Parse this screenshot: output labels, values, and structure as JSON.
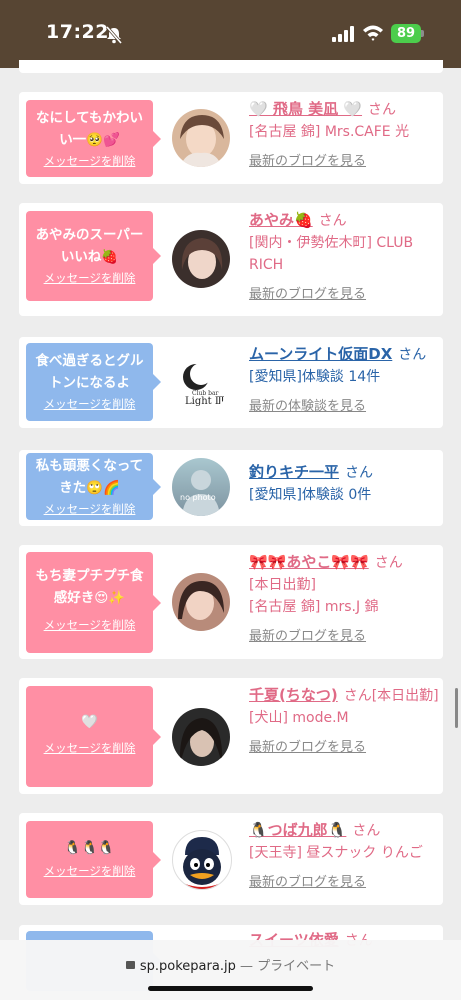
{
  "status": {
    "time": "17:22",
    "battery": "89"
  },
  "cards": [
    {
      "message": "なにしてもかわいい一🥺💕",
      "delete_label": "メッセージを削除",
      "bubble_color": "#ff8fa4",
      "name": "🤍 飛鳥 美凪 🤍",
      "suffix": "さん",
      "details": [
        "[名古屋 錦] Mrs.CAFE 光"
      ],
      "link": "最新のブログを見る"
    },
    {
      "message": "あやみのスーパーいいね🍓",
      "delete_label": "メッセージを削除",
      "bubble_color": "#ff8fa4",
      "name": "あやみ🍓",
      "suffix": "さん",
      "details": [
        "[関内・伊勢佐木町] CLUB RICH"
      ],
      "link": "最新のブログを見る"
    },
    {
      "message": "食べ過ぎるとグルトンになるよ",
      "delete_label": "メッセージを削除",
      "bubble_color": "#8fb8ec",
      "name": "ムーンライト仮面DX",
      "suffix": "さん",
      "details": [
        "[愛知県]体験談 14件"
      ],
      "link": "最新の体験談を見る",
      "avatar_text": [
        "Club bar",
        "Light Ⅲ"
      ]
    },
    {
      "message": "私も頭悪くなってきた🙄🌈",
      "delete_label": "メッセージを削除",
      "bubble_color": "#8fb8ec",
      "name": "釣りキチ一平",
      "suffix": "さん",
      "details": [
        "[愛知県]体験談 0件"
      ],
      "avatar_text": [
        "no photo"
      ]
    },
    {
      "message": "もち妻プチプチ食感好き😍✨",
      "delete_label": "メッセージを削除",
      "bubble_color": "#ff8fa4",
      "name": "🎀🎀あやこ🎀🎀",
      "suffix": "さん",
      "details": [
        "[本日出勤]",
        "[名古屋 錦] mrs.J 錦"
      ],
      "link": "最新のブログを見る"
    },
    {
      "message": "🤍",
      "delete_label": "メッセージを削除",
      "bubble_color": "#ff8fa4",
      "name": "千夏(ちなつ)",
      "suffix": "さん[本日出勤]",
      "details": [
        "[犬山] mode.M"
      ],
      "link": "最新のブログを見る"
    },
    {
      "message": "🐧🐧🐧",
      "delete_label": "メッセージを削除",
      "bubble_color": "#ff8fa4",
      "name": "🐧つば九郎🐧",
      "suffix": "さん",
      "details": [
        "[天王寺] 昼スナック りんご"
      ],
      "link": "最新のブログを見る"
    },
    {
      "name": "スイーツ依愛",
      "suffix": "さん"
    }
  ],
  "browser": {
    "domain": "sp.pokepara.jp",
    "separator": "—",
    "mode": "プライベート"
  }
}
